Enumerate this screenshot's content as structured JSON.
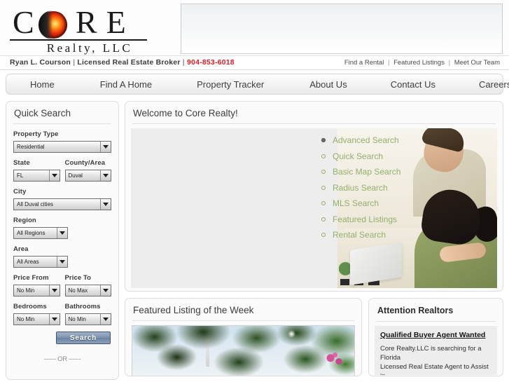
{
  "brand": {
    "logo_main": "CORE",
    "logo_letters": [
      "C",
      "O",
      "R",
      "E"
    ],
    "logo_sub": "Realty, LLC",
    "accent_red": "#e01b24",
    "link_green": "#93b06c"
  },
  "broker": {
    "name": "Ryan L. Courson",
    "sep1": "|",
    "title": "Licensed Real Estate Broker",
    "sep2": "|",
    "phone": "904-853-6018"
  },
  "util_links": [
    {
      "label": "Find a Rental"
    },
    {
      "label": "Featured Listings"
    },
    {
      "label": "Meet Our Team"
    }
  ],
  "util_separator": "|",
  "nav": [
    {
      "label": "Home"
    },
    {
      "label": "Find A Home"
    },
    {
      "label": "Property Tracker"
    },
    {
      "label": "About Us"
    },
    {
      "label": "Contact Us"
    },
    {
      "label": "Careers"
    }
  ],
  "sidebar": {
    "title": "Quick Search",
    "fields": {
      "property_type": {
        "label": "Property Type",
        "value": "Residential"
      },
      "state": {
        "label": "State",
        "value": "FL"
      },
      "county": {
        "label": "County/Area",
        "value": "Duval"
      },
      "city": {
        "label": "City",
        "value": "All Duval cities"
      },
      "region": {
        "label": "Region",
        "value": "All Regions"
      },
      "area": {
        "label": "Area",
        "value": "All Areas"
      },
      "price_from": {
        "label": "Price From",
        "value": "No Min"
      },
      "price_to": {
        "label": "Price To",
        "value": "No Max"
      },
      "bedrooms": {
        "label": "Bedrooms",
        "value": "No Min"
      },
      "bathrooms": {
        "label": "Bathrooms",
        "value": "No Min"
      }
    },
    "search_button": "Search",
    "or_divider": "------ OR ------"
  },
  "welcome": {
    "title": "Welcome to Core Realty!",
    "links": [
      {
        "label": "Advanced Search"
      },
      {
        "label": "Quick Search"
      },
      {
        "label": "Basic Map Search"
      },
      {
        "label": "Radius Search"
      },
      {
        "label": "MLS Search"
      },
      {
        "label": "Featured Listings"
      },
      {
        "label": "Rental Search"
      }
    ]
  },
  "featured": {
    "title": "Featured Listing of the Week"
  },
  "realtors": {
    "title": "Attention Realtors",
    "heading": "Qualified Buyer Agent Wanted",
    "body_line1": "Core Realty.LLC is searching for a Florida",
    "body_line2": "Licensed Real Estate Agent to Assist in"
  }
}
